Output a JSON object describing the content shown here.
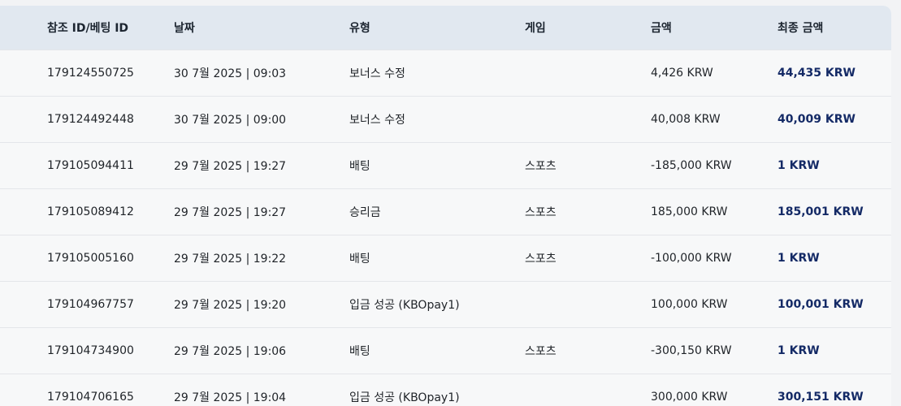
{
  "columns": {
    "ref_id": "참조 ID/베팅 ID",
    "date": "날짜",
    "type": "유형",
    "game": "게임",
    "amount": "금액",
    "final_amount": "최종 금액"
  },
  "rows": [
    {
      "ref_id": "179124550725",
      "date": "30 7월 2025 | 09:03",
      "type": "보너스 수정",
      "game": "",
      "amount": "4,426 KRW",
      "final_amount": "44,435 KRW"
    },
    {
      "ref_id": "179124492448",
      "date": "30 7월 2025 | 09:00",
      "type": "보너스 수정",
      "game": "",
      "amount": "40,008 KRW",
      "final_amount": "40,009 KRW"
    },
    {
      "ref_id": "179105094411",
      "date": "29 7월 2025 | 19:27",
      "type": "배팅",
      "game": "스포츠",
      "amount": "-185,000 KRW",
      "final_amount": "1 KRW"
    },
    {
      "ref_id": "179105089412",
      "date": "29 7월 2025 | 19:27",
      "type": "승리금",
      "game": "스포츠",
      "amount": "185,000 KRW",
      "final_amount": "185,001 KRW"
    },
    {
      "ref_id": "179105005160",
      "date": "29 7월 2025 | 19:22",
      "type": "배팅",
      "game": "스포츠",
      "amount": "-100,000 KRW",
      "final_amount": "1 KRW"
    },
    {
      "ref_id": "179104967757",
      "date": "29 7월 2025 | 19:20",
      "type": "입금 성공 (KBOpay1)",
      "game": "",
      "amount": "100,000 KRW",
      "final_amount": "100,001 KRW"
    },
    {
      "ref_id": "179104734900",
      "date": "29 7월 2025 | 19:06",
      "type": "배팅",
      "game": "스포츠",
      "amount": "-300,150 KRW",
      "final_amount": "1 KRW"
    },
    {
      "ref_id": "179104706165",
      "date": "29 7월 2025 | 19:04",
      "type": "입금 성공 (KBOpay1)",
      "game": "",
      "amount": "300,000 KRW",
      "final_amount": "300,151 KRW"
    }
  ]
}
